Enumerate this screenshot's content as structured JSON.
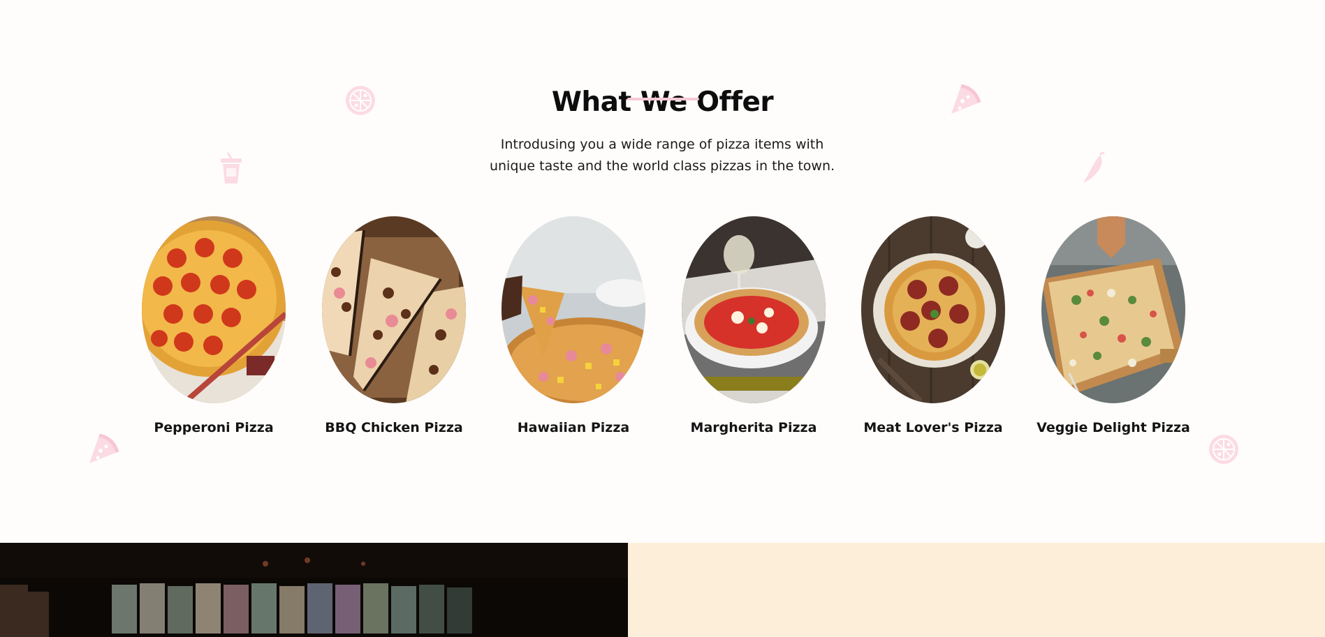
{
  "section": {
    "title": "What We Offer",
    "subtitle_line1": "Introdusing you a wide range of pizza items with",
    "subtitle_line2": "unique taste and the world class pizzas in the town."
  },
  "pizzas": [
    {
      "name": "Pepperoni Pizza"
    },
    {
      "name": "BBQ Chicken Pizza"
    },
    {
      "name": "Hawaiian Pizza"
    },
    {
      "name": "Margherita Pizza"
    },
    {
      "name": "Meat Lover's Pizza"
    },
    {
      "name": "Veggie Delight Pizza"
    }
  ],
  "decorations": [
    "pizza-icon",
    "pizza-slice-icon",
    "drink-cup-icon",
    "chili-icon"
  ],
  "colors": {
    "background": "#fffdfb",
    "accent_pink": "#f6c9d6",
    "footer_left": "#0b0806",
    "footer_right": "#fdeed9"
  }
}
